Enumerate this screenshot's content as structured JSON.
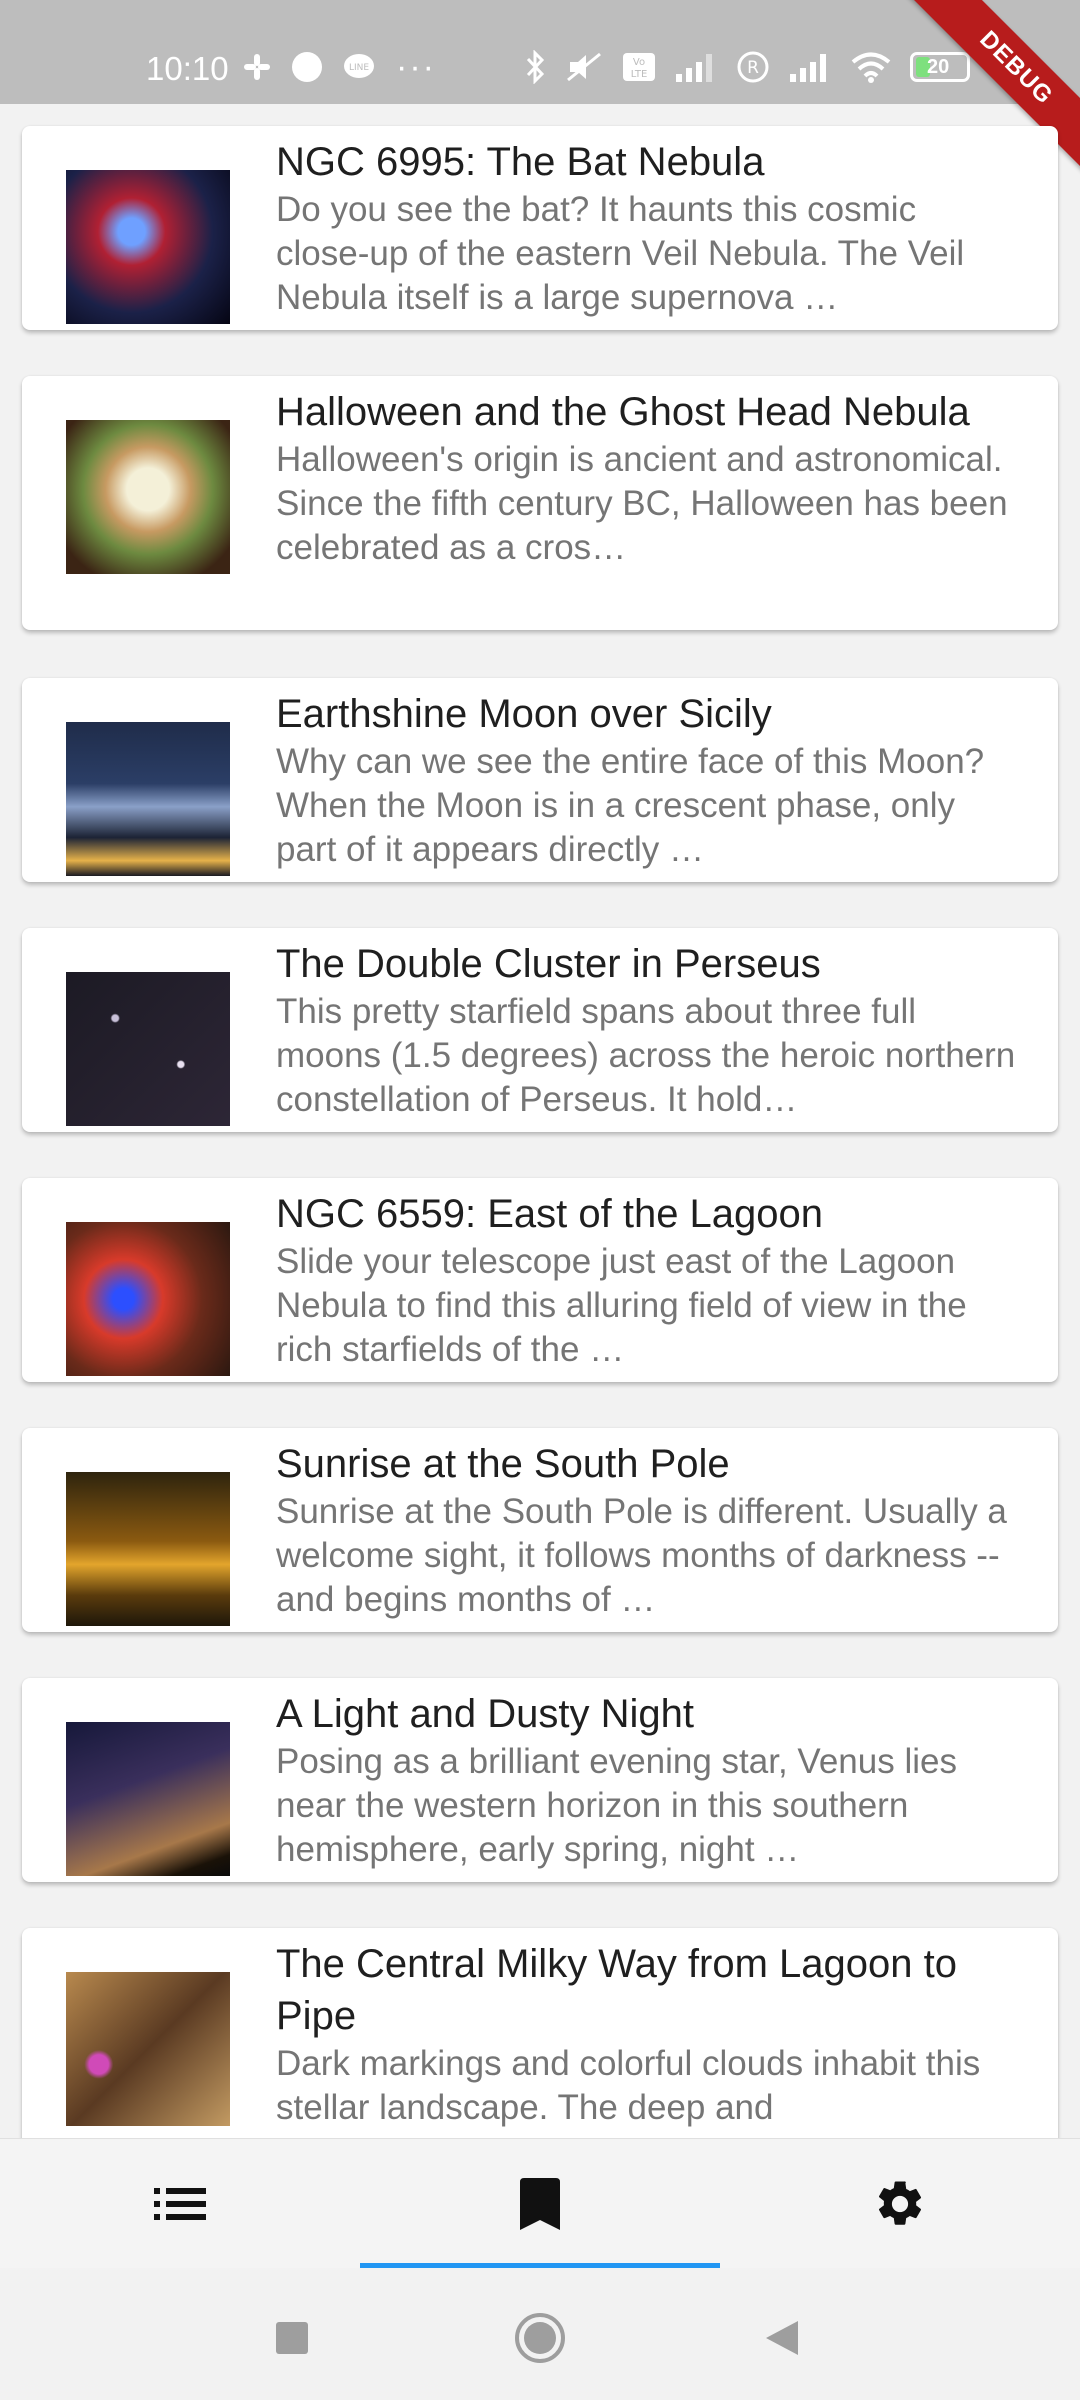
{
  "status_bar": {
    "time": "10:10",
    "battery_level": "20",
    "left_icons": [
      "slack-icon",
      "app-icon",
      "line-icon",
      "more-dots-icon"
    ],
    "right_icons": [
      "bluetooth-icon",
      "mute-icon",
      "volte-icon",
      "signal-icon",
      "registered-icon",
      "signal-icon",
      "wifi-icon",
      "battery-icon"
    ]
  },
  "debug_banner": "DEBUG",
  "items": [
    {
      "title": "NGC 6995: The Bat Nebula",
      "desc": "Do you see the bat?  It haunts this cosmic close-up of the eastern Veil Nebula.  The Veil Nebula itself is a large supernova …"
    },
    {
      "title": "Halloween and the Ghost Head Nebula",
      "desc": "Halloween's origin is ancient and astronomical.  Since the fifth century BC, Halloween has been celebrated as a cros…"
    },
    {
      "title": "Earthshine Moon over Sicily",
      "desc": "Why can we see the entire face of this Moon?  When the Moon is in a crescent phase, only part of it appears directly …"
    },
    {
      "title": "The Double Cluster in Perseus",
      "desc": "This pretty starfield spans about three full moons (1.5 degrees) across the heroic northern constellation of Perseus. It hold…"
    },
    {
      "title": "NGC 6559: East of the Lagoon",
      "desc": "Slide your telescope just east of the Lagoon Nebula to find this alluring field of view in the rich starfields of the …"
    },
    {
      "title": "Sunrise at the South Pole",
      "desc": "Sunrise at the South Pole is different.  Usually a welcome sight, it follows months of darkness -- and begins months of …"
    },
    {
      "title": "A Light and Dusty Night",
      "desc": "Posing as a brilliant evening star, Venus lies near the western horizon in this southern hemisphere, early spring, night …"
    },
    {
      "title": "The Central Milky Way from Lagoon to Pipe",
      "desc": "Dark markings and colorful clouds inhabit this stellar landscape. The deep and"
    }
  ],
  "tabs": [
    {
      "icon": "list-icon",
      "active": false
    },
    {
      "icon": "bookmark-icon",
      "active": true
    },
    {
      "icon": "gear-icon",
      "active": false
    }
  ],
  "colors": {
    "accent": "#2196f3",
    "debug": "#b71c1c"
  }
}
